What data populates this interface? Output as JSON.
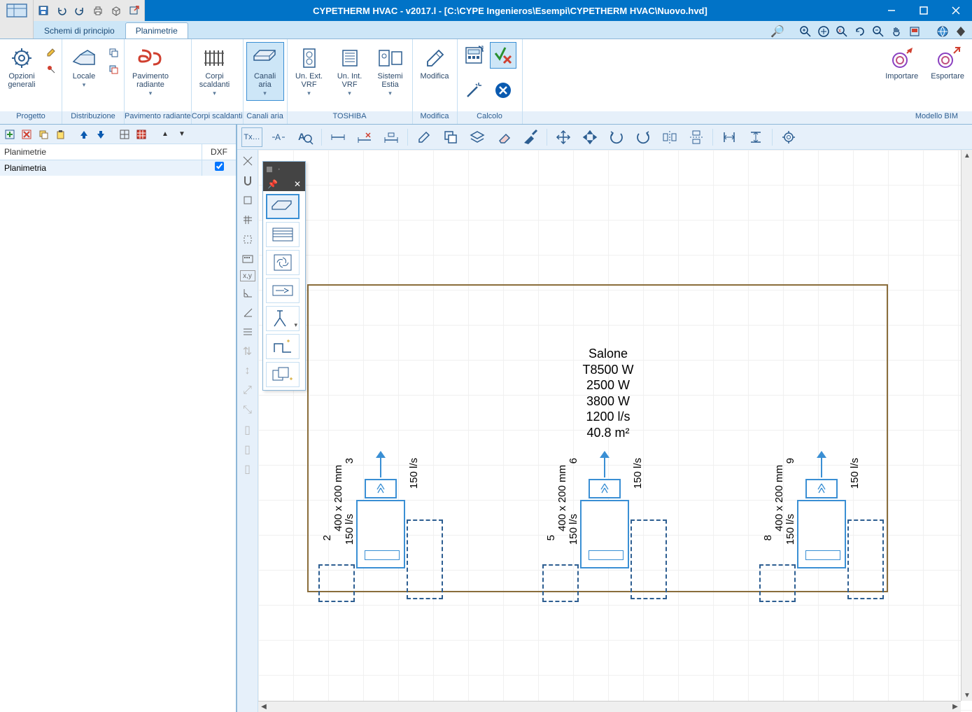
{
  "title": "CYPETHERM HVAC - v2017.l - [C:\\CYPE Ingenieros\\Esempi\\CYPETHERM HVAC\\Nuovo.hvd]",
  "tabs": {
    "schemi": "Schemi di principio",
    "planimetrie": "Planimetrie"
  },
  "ribbon": {
    "groups": {
      "progetto": "Progetto",
      "distribuzione": "Distribuzione",
      "pavimento": "Pavimento radiante",
      "corpi": "Corpi scaldanti",
      "canali": "Canali aria",
      "toshiba": "TOSHIBA",
      "modifica": "Modifica",
      "calcolo": "Calcolo",
      "bim": "Modello BIM"
    },
    "btns": {
      "opzioni": "Opzioni\ngenerali",
      "locale": "Locale",
      "pav_radiante": "Pavimento\nradiante",
      "corpi_scaldanti": "Corpi\nscaldanti",
      "canali_aria": "Canali\naria",
      "un_ext_vrf": "Un. Ext.\nVRF",
      "un_int_vrf": "Un. Int.\nVRF",
      "sistemi_estia": "Sistemi\nEstia",
      "modifica": "Modifica",
      "importare": "Importare",
      "esportare": "Esportare"
    }
  },
  "side": {
    "header": {
      "col1": "Planimetrie",
      "col2": "DXF"
    },
    "row": {
      "name": "Planimetria",
      "checked": true
    }
  },
  "room": {
    "name": "Salone",
    "line1": "T8500 W",
    "line2": "2500 W",
    "line3": "3800 W",
    "line4": "1200 l/s",
    "line5": "40.8 m²"
  },
  "diffusers": [
    {
      "id_low": "2",
      "id_high": "3",
      "size": "400 x 200 mm",
      "flow_low": "150 l/s",
      "flow_high": "150 l/s"
    },
    {
      "id_low": "5",
      "id_high": "6",
      "size": "400 x 200 mm",
      "flow_low": "150 l/s",
      "flow_high": "150 l/s"
    },
    {
      "id_low": "8",
      "id_high": "9",
      "size": "400 x 200 mm",
      "flow_low": "150 l/s",
      "flow_high": "150 l/s"
    }
  ]
}
